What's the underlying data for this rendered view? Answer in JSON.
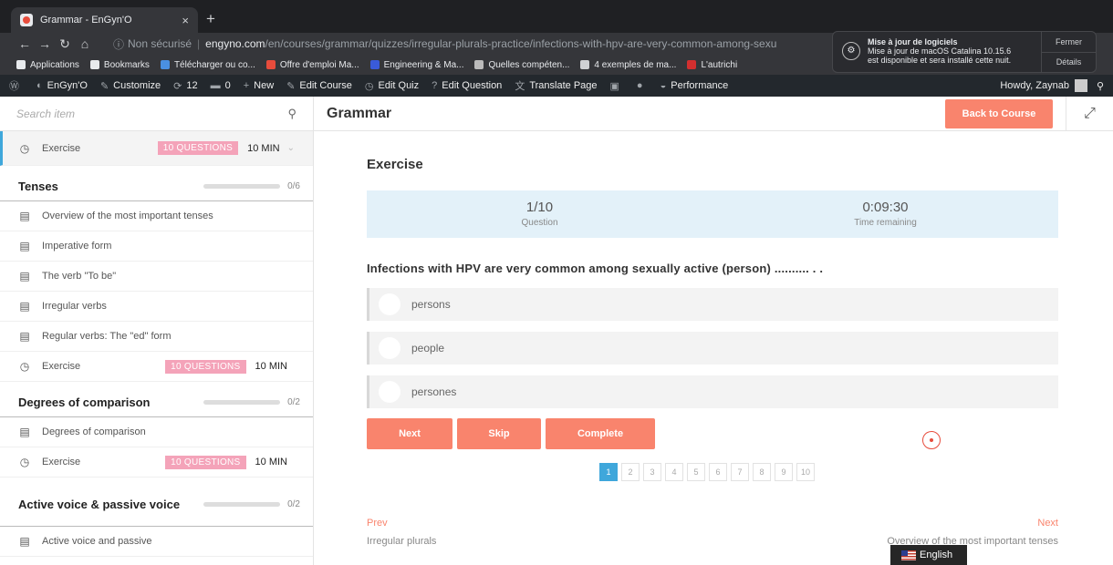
{
  "browser": {
    "tab_title": "Grammar - EnGyn'O",
    "tab_close": "×",
    "new_tab": "+",
    "security": "Non sécurisé",
    "url_host": "engyno.com",
    "url_path": "/en/courses/grammar/quizzes/irregular-plurals-practice/infections-with-hpv-are-very-common-among-sexu",
    "bookmarks": [
      {
        "label": "Applications",
        "icon": "apps-grid-icon",
        "color": "#e8eaed"
      },
      {
        "label": "Bookmarks",
        "icon": "star-icon",
        "color": "#e8eaed"
      },
      {
        "label": "Télécharger ou co...",
        "icon": "app-icon",
        "color": "#4a90e2"
      },
      {
        "label": "Offre d'emploi Ma...",
        "icon": "app-icon",
        "color": "#e74c3c"
      },
      {
        "label": "Engineering & Ma...",
        "icon": "app-icon",
        "color": "#3a5bd9"
      },
      {
        "label": "Quelles compéten...",
        "icon": "app-icon",
        "color": "#bbbbbb"
      },
      {
        "label": "4 exemples de ma...",
        "icon": "app-icon",
        "color": "#cfd1d4"
      },
      {
        "label": "L'autrichi",
        "icon": "app-icon",
        "color": "#d32f2f"
      }
    ]
  },
  "notification": {
    "title": "Mise à jour de logiciels",
    "line1": "Mise à jour de macOS Catalina 10.15.6",
    "line2": "est disponible et sera installé cette nuit.",
    "close_label": "Fermer",
    "details_label": "Détails"
  },
  "adminbar": {
    "site": "EnGyn'O",
    "customize": "Customize",
    "updates": "12",
    "comments": "0",
    "new": "New",
    "edit_course": "Edit Course",
    "edit_quiz": "Edit Quiz",
    "edit_question": "Edit Question",
    "translate": "Translate Page",
    "performance": "Performance",
    "howdy": "Howdy, Zaynab"
  },
  "sidebar": {
    "search_placeholder": "Search item",
    "current": {
      "label": "Exercise",
      "badge": "10 QUESTIONS",
      "duration": "10 MIN"
    },
    "sections": [
      {
        "title": "Tenses",
        "progress": "0/6",
        "progress_fraction": 0,
        "items": [
          {
            "type": "lesson",
            "label": "Overview of the most important tenses"
          },
          {
            "type": "lesson",
            "label": "Imperative form"
          },
          {
            "type": "lesson",
            "label": "The verb \"To be\""
          },
          {
            "type": "lesson",
            "label": "Irregular verbs"
          },
          {
            "type": "lesson",
            "label": "Regular verbs: The \"ed\" form"
          },
          {
            "type": "quiz",
            "label": "Exercise",
            "badge": "10 QUESTIONS",
            "duration": "10 MIN"
          }
        ]
      },
      {
        "title": "Degrees of comparison",
        "progress": "0/2",
        "progress_fraction": 0,
        "items": [
          {
            "type": "lesson",
            "label": "Degrees of comparison"
          },
          {
            "type": "quiz",
            "label": "Exercise",
            "badge": "10 QUESTIONS",
            "duration": "10 MIN"
          }
        ]
      },
      {
        "title": "Active voice & passive voice",
        "progress": "0/2",
        "progress_fraction": 0,
        "items": [
          {
            "type": "lesson",
            "label": "Active voice and passive"
          }
        ]
      }
    ]
  },
  "main": {
    "course_title": "Grammar",
    "back_label": "Back to Course",
    "quiz_title": "Exercise",
    "question_counter": "1/10",
    "question_caption": "Question",
    "time_value": "0:09:30",
    "time_caption": "Time remaining",
    "question_text": "Infections with HPV are very common among sexually active (person) .......... . .",
    "options": [
      "persons",
      "people",
      "persones"
    ],
    "buttons": {
      "next": "Next",
      "skip": "Skip",
      "complete": "Complete"
    },
    "pages": [
      "1",
      "2",
      "3",
      "4",
      "5",
      "6",
      "7",
      "8",
      "9",
      "10"
    ],
    "current_page": "1",
    "prev_label": "Prev",
    "prev_item": "Irregular plurals",
    "next_label": "Next",
    "next_item": "Overview of the most important tenses",
    "language": "English"
  },
  "colors": {
    "accent": "#f9846d",
    "active_blue": "#3fa7db",
    "badge_pink": "#f4a3b9",
    "info_bg": "#e3f1f9"
  }
}
